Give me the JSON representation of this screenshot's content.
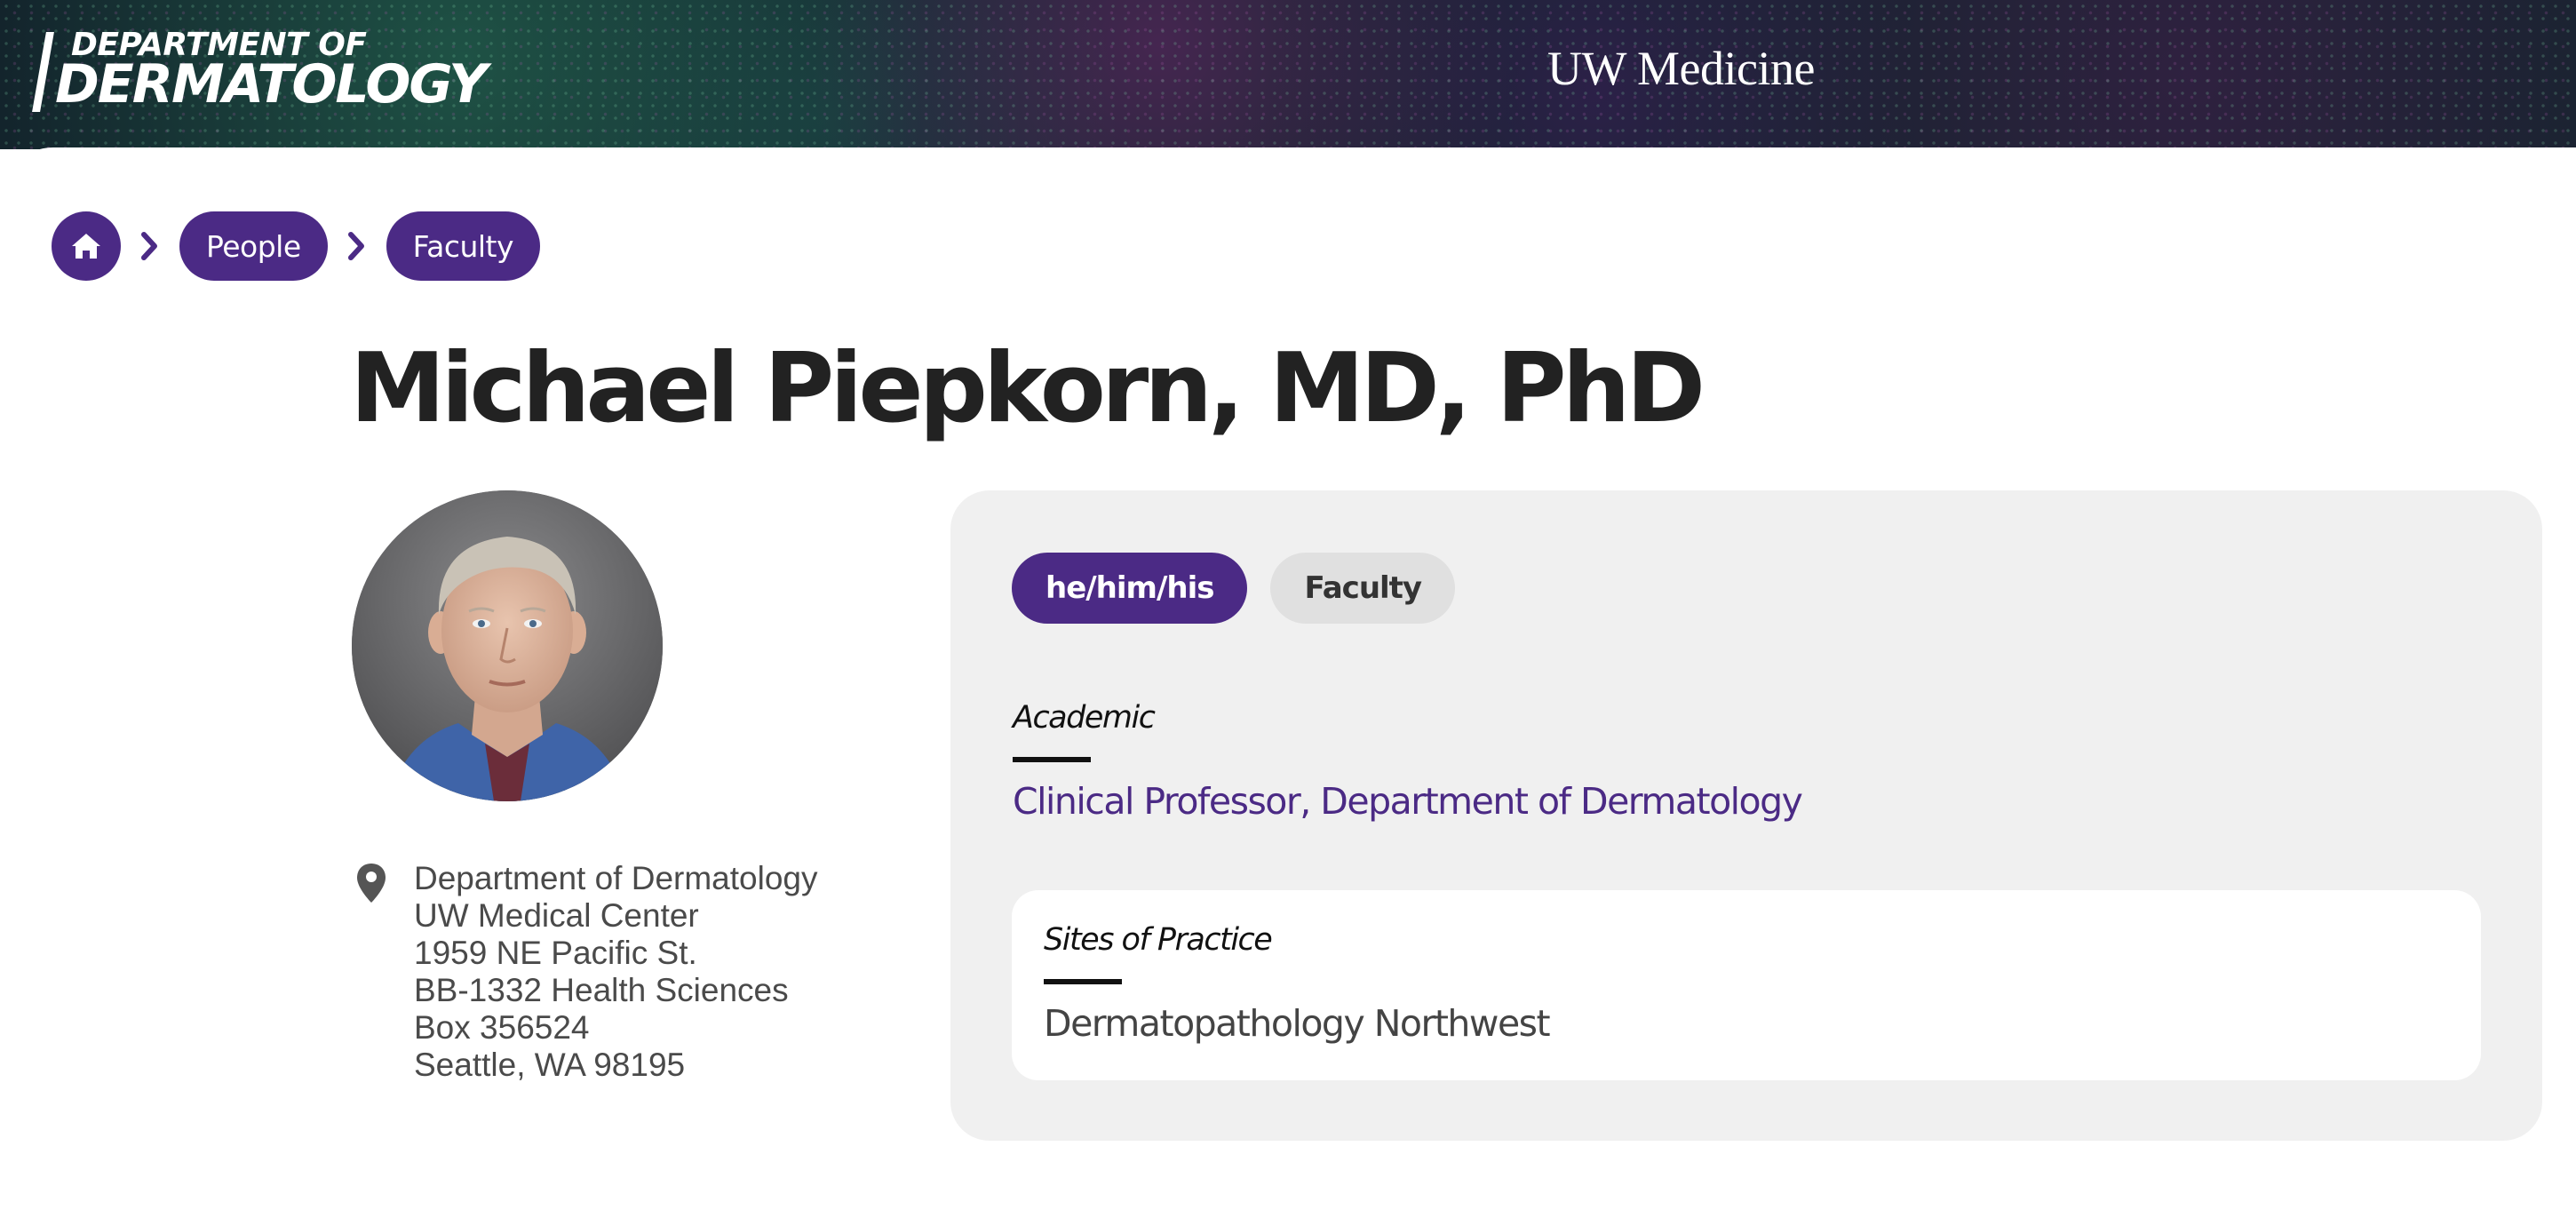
{
  "header": {
    "logo_line1": "DEPARTMENT OF",
    "logo_line2": "DERMATOLOGY",
    "partner": "UW Medicine"
  },
  "breadcrumb": {
    "home_icon": "home-icon",
    "separator_icon": "chevron-right-icon",
    "items": [
      {
        "label": "People"
      },
      {
        "label": "Faculty"
      }
    ]
  },
  "profile": {
    "name": "Michael Piepkorn, MD, PhD",
    "address_icon": "map-pin-icon",
    "address": [
      "Department of Dermatology",
      "UW Medical Center",
      "1959 NE Pacific St.",
      "BB-1332 Health Sciences",
      "Box 356524",
      "Seattle, WA 98195"
    ],
    "pronouns": "he/him/his",
    "type": "Faculty",
    "academic": {
      "label": "Academic",
      "title": "Clinical Professor, Department of Dermatology"
    },
    "sites": {
      "label": "Sites of Practice",
      "value": "Dermatopathology Northwest"
    }
  },
  "colors": {
    "brand_purple": "#4b2a85",
    "panel_bg": "#f0f0f0",
    "header_bg": "#13242c"
  }
}
